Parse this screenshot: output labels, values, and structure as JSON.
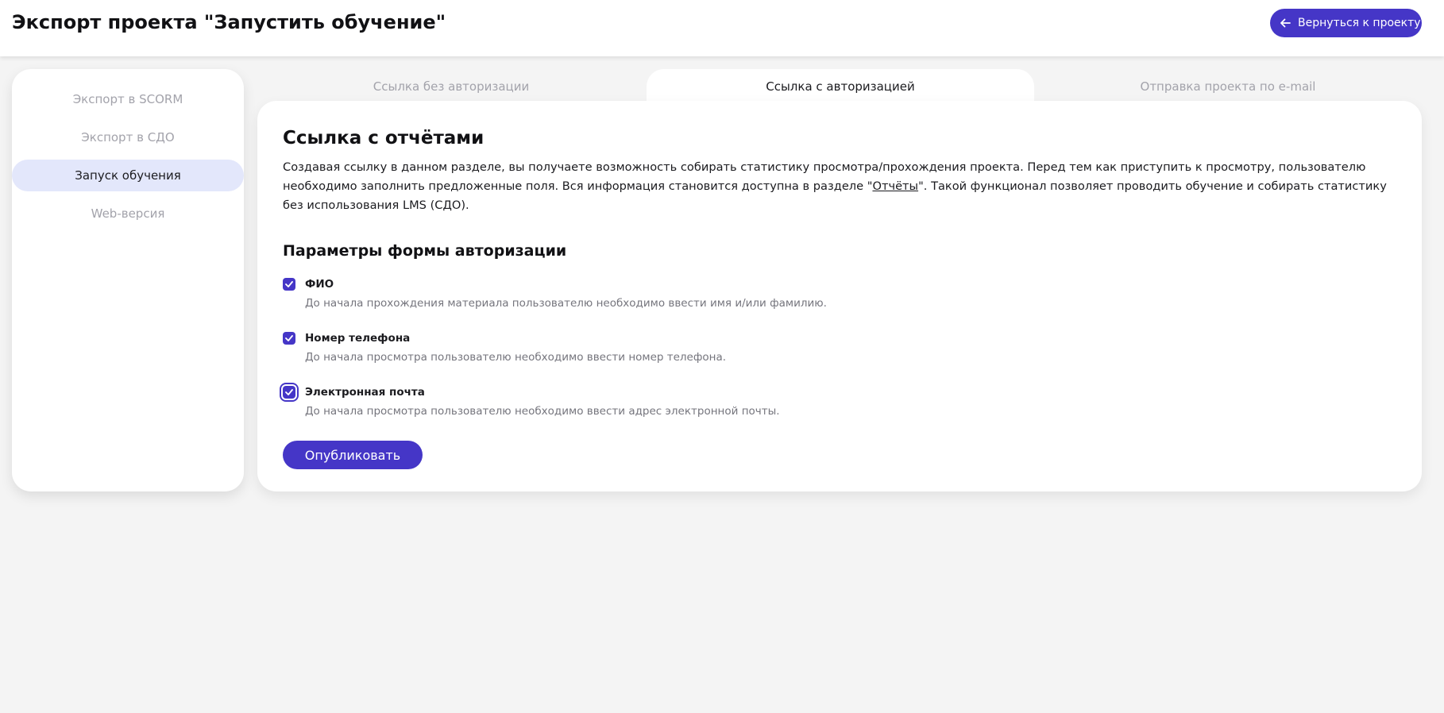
{
  "header": {
    "title": "Экспорт проекта \"Запустить обучение\"",
    "back_button": {
      "label": "Вернуться к проекту",
      "icon": "arrow-left-icon"
    }
  },
  "sidebar": {
    "items": [
      {
        "label": "Экспорт в SCORM",
        "active": false
      },
      {
        "label": "Экспорт в СДО",
        "active": false
      },
      {
        "label": "Запуск обучения",
        "active": true
      },
      {
        "label": "Web-версия",
        "active": false
      }
    ]
  },
  "tabs": [
    {
      "label": "Ссылка без авторизации",
      "active": false
    },
    {
      "label": "Ссылка с авторизацией",
      "active": true
    },
    {
      "label": "Отправка проекта по e-mail",
      "active": false
    }
  ],
  "content": {
    "title": "Ссылка с отчётами",
    "description_before": "Создавая ссылку в данном разделе, вы получаете возможность собирать статистику просмотра/прохождения проекта. Перед тем как приступить к просмотру, пользователю необходимо заполнить предложенные поля. Вся информация становится доступна в разделе \"",
    "description_link": "Отчёты",
    "description_after": "\". Такой функционал позволяет проводить обучение и собирать статистику без использования LMS (СДО).",
    "section_title": "Параметры формы авторизации",
    "options": [
      {
        "label": "ФИО",
        "hint": "До начала прохождения материала пользователю необходимо ввести имя и/или фамилию.",
        "checked": true
      },
      {
        "label": "Номер телефона",
        "hint": "До начала просмотра пользователю необходимо ввести номер телефона.",
        "checked": true
      },
      {
        "label": "Электронная почта",
        "hint": "До начала просмотра пользователю необходимо ввести адрес электронной почты.",
        "checked": true
      }
    ],
    "publish_button": "Опубликовать"
  },
  "colors": {
    "accent": "#4536c7",
    "active_sidebar_bg": "#e3e7fb",
    "page_bg": "#f4f4f4",
    "muted_text": "#a3a3ab"
  }
}
